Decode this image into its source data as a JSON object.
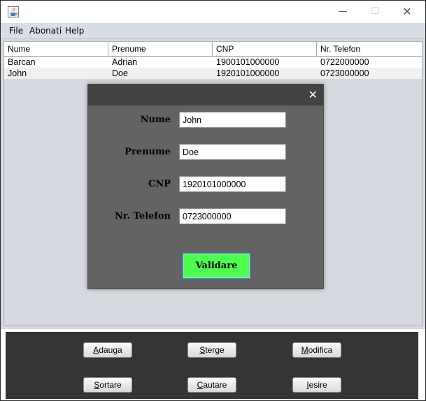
{
  "window": {
    "title": "",
    "controls": {
      "minimize": "—",
      "maximize": "☐",
      "close": "✕"
    }
  },
  "menu": [
    "File",
    "Abonati",
    "Help"
  ],
  "table": {
    "columns": [
      "Nume",
      "Prenume",
      "CNP",
      "Nr. Telefon"
    ],
    "rows": [
      [
        "Barcan",
        "Adrian",
        "1900101000000",
        "0722000000"
      ],
      [
        "John",
        "Doe",
        "1920101000000",
        "0723000000"
      ]
    ]
  },
  "buttons": {
    "adauga": "Adauga",
    "sterge": "Sterge",
    "modifica": "Modifica",
    "sortare": "Sortare",
    "cautare": "Cautare",
    "iesire": "Iesire"
  },
  "dialog": {
    "close": "✕",
    "fields": [
      {
        "label": "Nume",
        "value": "John"
      },
      {
        "label": "Prenume",
        "value": "Doe"
      },
      {
        "label": "CNP",
        "value": "1920101000000"
      },
      {
        "label": "Nr. Telefon",
        "value": "0723000000"
      }
    ],
    "submit": "Validare"
  },
  "colors": {
    "validate_button": "#4cff4c",
    "dialog_bg": "#636363",
    "footer_bg": "#353535",
    "menubar_bg": "#d8dde6"
  },
  "icons": {
    "app": "java-cup-icon"
  }
}
